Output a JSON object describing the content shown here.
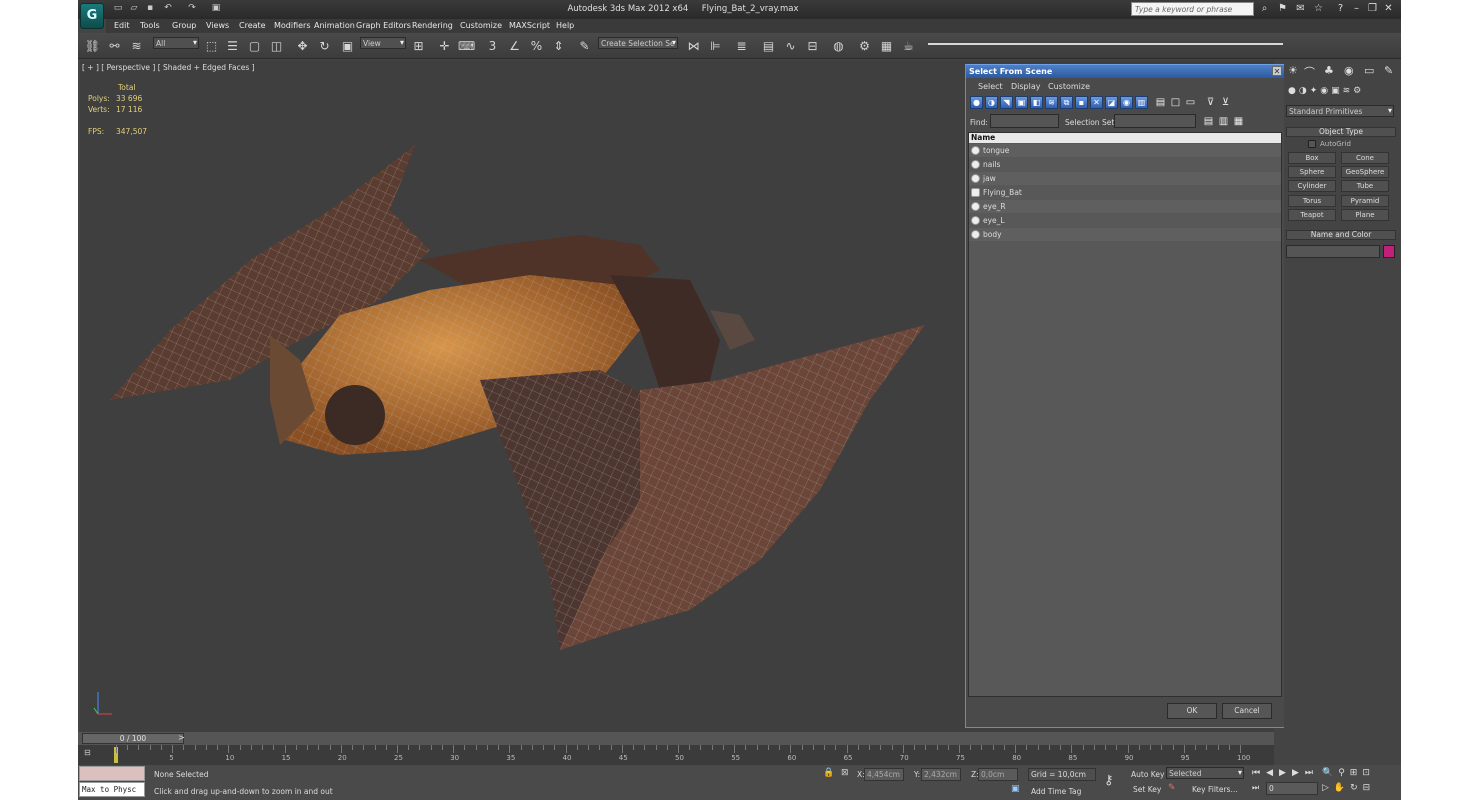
{
  "title": {
    "app": "Autodesk 3ds Max  2012 x64",
    "file": "Flying_Bat_2_vray.max"
  },
  "search": {
    "placeholder": "Type a keyword or phrase"
  },
  "menu": [
    "Edit",
    "Tools",
    "Group",
    "Views",
    "Create",
    "Modifiers",
    "Animation",
    "Graph Editors",
    "Rendering",
    "Customize",
    "MAXScript",
    "Help"
  ],
  "toolbar": {
    "filter": "All",
    "refcoord": "View",
    "selset": "Create Selection Se",
    "spinner_3": "3",
    "spinner_pct": "%"
  },
  "viewport": {
    "label": "[ + ] [ Perspective ] [ Shaded + Edged Faces ]",
    "stats": {
      "total": "Total",
      "polys_label": "Polys:",
      "polys": "33 696",
      "verts_label": "Verts:",
      "verts": "17 116",
      "fps_label": "FPS:",
      "fps": "347,507"
    }
  },
  "dialog": {
    "title": "Select From Scene",
    "menus": [
      "Select",
      "Display",
      "Customize"
    ],
    "find_label": "Find:",
    "selset_label": "Selection Set:",
    "col_name": "Name",
    "items": [
      "tongue",
      "nails",
      "jaw",
      "Flying_Bat",
      "eye_R",
      "eye_L",
      "body"
    ],
    "ok": "OK",
    "cancel": "Cancel"
  },
  "cmd": {
    "category": "Standard Primitives",
    "object_type": "Object Type",
    "autogrid": "AutoGrid",
    "prims": [
      "Box",
      "Cone",
      "Sphere",
      "GeoSphere",
      "Cylinder",
      "Tube",
      "Torus",
      "Pyramid",
      "Teapot",
      "Plane"
    ],
    "name_color": "Name and Color",
    "color": "#c0207a"
  },
  "timeline": {
    "slider": "0 / 100",
    "ticks": [
      "0",
      "5",
      "10",
      "15",
      "20",
      "25",
      "30",
      "35",
      "40",
      "45",
      "50",
      "55",
      "60",
      "65",
      "70",
      "75",
      "80",
      "85",
      "90",
      "95",
      "100"
    ]
  },
  "status": {
    "maxscript": "Max to Physc",
    "selected": "None Selected",
    "prompt": "Click and drag up-and-down to zoom in and out",
    "x_label": "X:",
    "x": "4,454cm",
    "y_label": "Y:",
    "y": "2,432cm",
    "z_label": "Z:",
    "z": "0,0cm",
    "grid": "Grid = 10,0cm",
    "autokey": "Auto Key",
    "setkey": "Set Key",
    "keymode": "Selected",
    "keyfilters": "Key Filters...",
    "addtimetag": "Add Time Tag",
    "frame": "0"
  }
}
